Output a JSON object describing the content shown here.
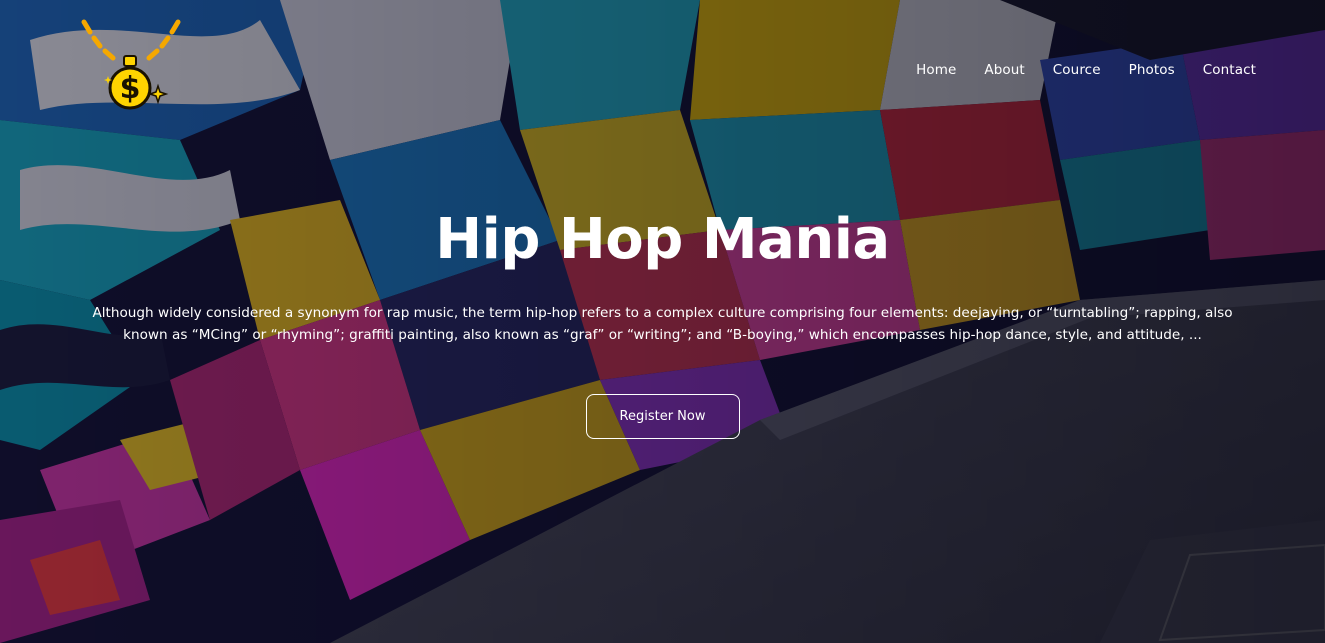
{
  "brand": {
    "logo_icon": "gold-chain-dollar-icon",
    "colors": {
      "chain": "#f5a800",
      "pendant": "#ffd400",
      "outline": "#1a1200"
    }
  },
  "nav": {
    "items": [
      {
        "label": "Home"
      },
      {
        "label": "About"
      },
      {
        "label": "Cource"
      },
      {
        "label": "Photos"
      },
      {
        "label": "Contact"
      }
    ]
  },
  "hero": {
    "title": "Hip Hop Mania",
    "description": "Although widely considered a synonym for rap music, the term hip-hop refers to a complex culture comprising four elements: deejaying, or “turntabling”; rapping, also known as “MCing” or “rhyming”; graffiti painting, also known as “graf” or “writing”; and “B-boying,” which encompasses hip-hop dance, style, and attitude, ...",
    "cta_label": "Register Now",
    "text_color": "#ffffff"
  }
}
